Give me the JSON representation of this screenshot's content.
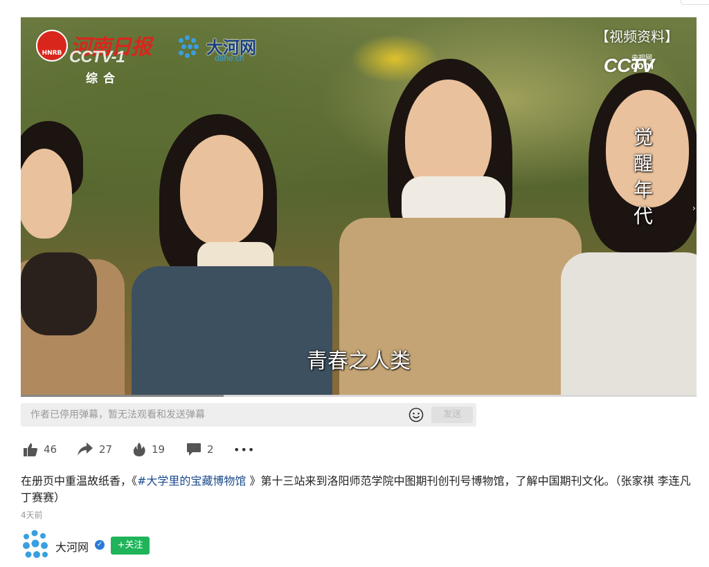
{
  "video": {
    "logo_hnrb_badge": "HNRB",
    "logo_hnrb_name": "河南日报",
    "channel_logo": "CCTV-1",
    "channel_sub": "综合",
    "partner_name": "大河网",
    "partner_domain": "dahe.cn",
    "label": "【视频资料】",
    "cctv_com_logo": "CCTV",
    "cctv_com_cn": "央视网",
    "cctv_com_suffix": "com",
    "vertical_title": "觉醒年代",
    "subtitle": "青春之人类",
    "progress": 0.3
  },
  "danmaku": {
    "placeholder": "作者已停用弹幕，暂无法观看和发送弹幕",
    "emoji_icon": "smile-icon",
    "send_label": "发送"
  },
  "actions": {
    "like_count": "46",
    "share_count": "27",
    "hot_count": "19",
    "comment_count": "2",
    "more_label": "•••"
  },
  "post": {
    "desc_prefix": "在册页中重温故纸香，《",
    "desc_topic": "#大学里的宝藏博物馆",
    "desc_suffix": " 》第十三站来到洛阳师范学院中图期刊创刊号博物馆，了解中国期刊文化。（张家祺 李连凡 丁赛赛）",
    "time": "4天前"
  },
  "author": {
    "name": "大河网",
    "follow_label": "+关注"
  },
  "colors": {
    "follow_green": "#1fb45a",
    "topic_blue": "#1a4b8c",
    "verified_blue": "#2b7bd6"
  }
}
